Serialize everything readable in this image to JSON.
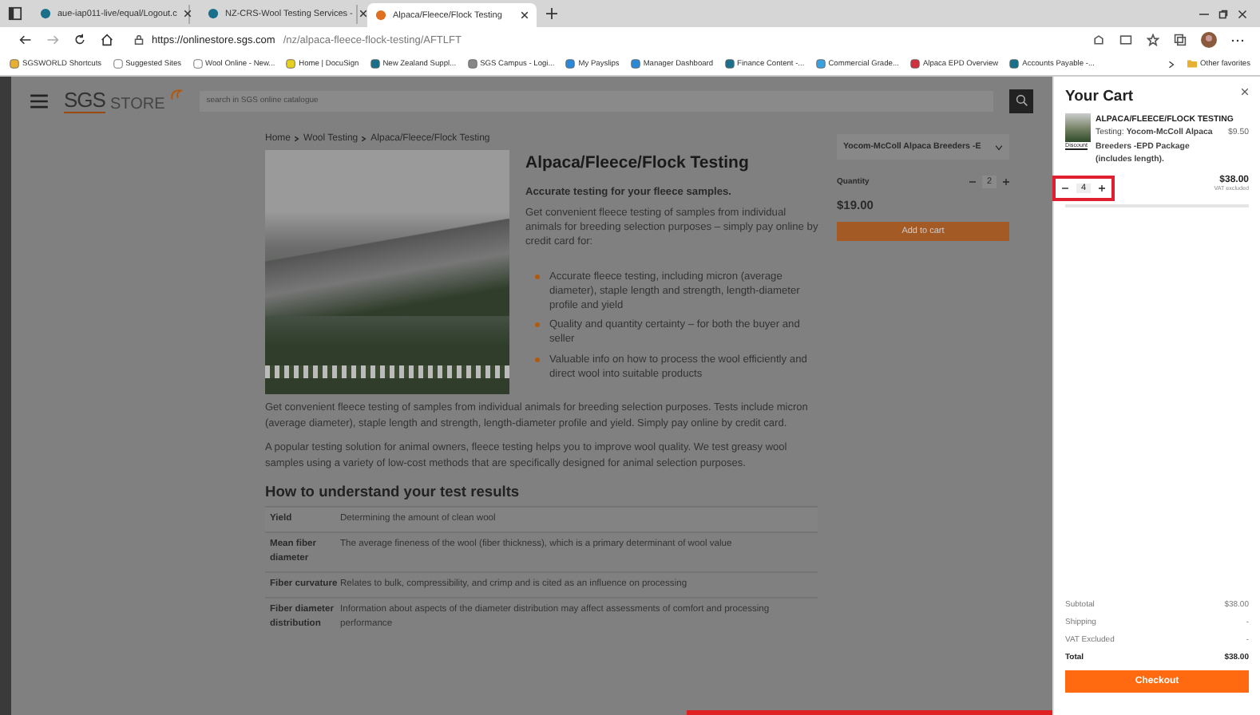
{
  "browser": {
    "tabs": [
      {
        "title": "aue-iap011-live/equal/Logout.c",
        "selected": false
      },
      {
        "title": "NZ-CRS-Wool Testing Services -",
        "selected": false
      },
      {
        "title": "Alpaca/Fleece/Flock Testing",
        "selected": true
      }
    ],
    "url_host": "https://onlinestore.sgs.com",
    "url_path": "/nz/alpaca-fleece-flock-testing/AFTLFT",
    "bookmarks": [
      "SGSWORLD Shortcuts",
      "Suggested Sites",
      "Wool Online - New...",
      "Home | DocuSign",
      "New Zealand Suppl...",
      "SGS Campus - Logi...",
      "My Payslips",
      "Manager Dashboard",
      "Finance Content -...",
      "Commercial Grade...",
      "Alpaca EPD Overview",
      "Accounts Payable -..."
    ],
    "other_favorites": "Other favorites"
  },
  "store": {
    "logo_main": "SGS",
    "logo_sub": "STORE",
    "search": {
      "placeholder": "search in SGS online catalogue"
    },
    "breadcrumb": [
      "Home",
      "Wool Testing",
      "Alpaca/Fleece/Flock Testing"
    ],
    "product": {
      "title": "Alpaca/Fleece/Flock Testing",
      "tagline": "Accurate testing for your fleece samples.",
      "intro": "Get convenient fleece testing of samples from individual animals for breeding selection purposes – simply pay online by credit card for:",
      "bullets": [
        "Accurate fleece testing, including micron (average diameter), staple length and strength, length-diameter profile and yield",
        "Quality and quantity certainty – for both the buyer and seller",
        "Valuable info on how to process the wool efficiently and direct wool into suitable products"
      ]
    },
    "order": {
      "variant": "Yocom-McColl Alpaca Breeders -E",
      "quantity_label": "Quantity",
      "quantity": "2",
      "price": "$19.00",
      "add_button": "Add to cart"
    },
    "paragraphs": [
      "Get convenient fleece testing of samples from individual animals for breeding selection purposes. Tests include micron (average diameter), staple length and strength, length-diameter profile and yield. Simply pay online by credit card.",
      "A popular testing solution for animal owners, fleece testing helps you to improve wool quality. We test greasy wool samples using a variety of low-cost methods that are specifically designed for animal selection purposes."
    ],
    "results_heading": "How to understand your test results",
    "results": [
      {
        "term": "Yield",
        "meaning": "Determining the amount of clean wool"
      },
      {
        "term": "Mean fiber diameter",
        "meaning": "The average fineness of the wool (fiber thickness), which is a primary determinant of wool value"
      },
      {
        "term": "Fiber curvature",
        "meaning": "Relates to bulk, compressibility, and crimp and is cited as an influence on processing"
      },
      {
        "term": "Fiber diameter distribution",
        "meaning": "Information about aspects of the diameter distribution may affect assessments of comfort and processing performance"
      }
    ]
  },
  "cart": {
    "title": "Your Cart",
    "item": {
      "thumb_caption": "Discount",
      "name": "ALPACA/FLEECE/FLOCK TESTING",
      "detail": "Testing: **Yocom-McColl Alpaca Breeders -EPD Package (includes length).**",
      "unit_price": "$9.50",
      "quantity": "4",
      "total": "$38.00",
      "vat_note": "VAT excluded"
    },
    "summary": [
      {
        "label": "Subtotal",
        "value": "$38.00",
        "kind": "normal"
      },
      {
        "label": "Shipping",
        "value": "-",
        "kind": "normal"
      },
      {
        "label": "VAT Excluded",
        "value": "-",
        "kind": "normal"
      },
      {
        "label": "Total",
        "value": "$38.00",
        "kind": "total"
      }
    ],
    "checkout": "Checkout"
  }
}
